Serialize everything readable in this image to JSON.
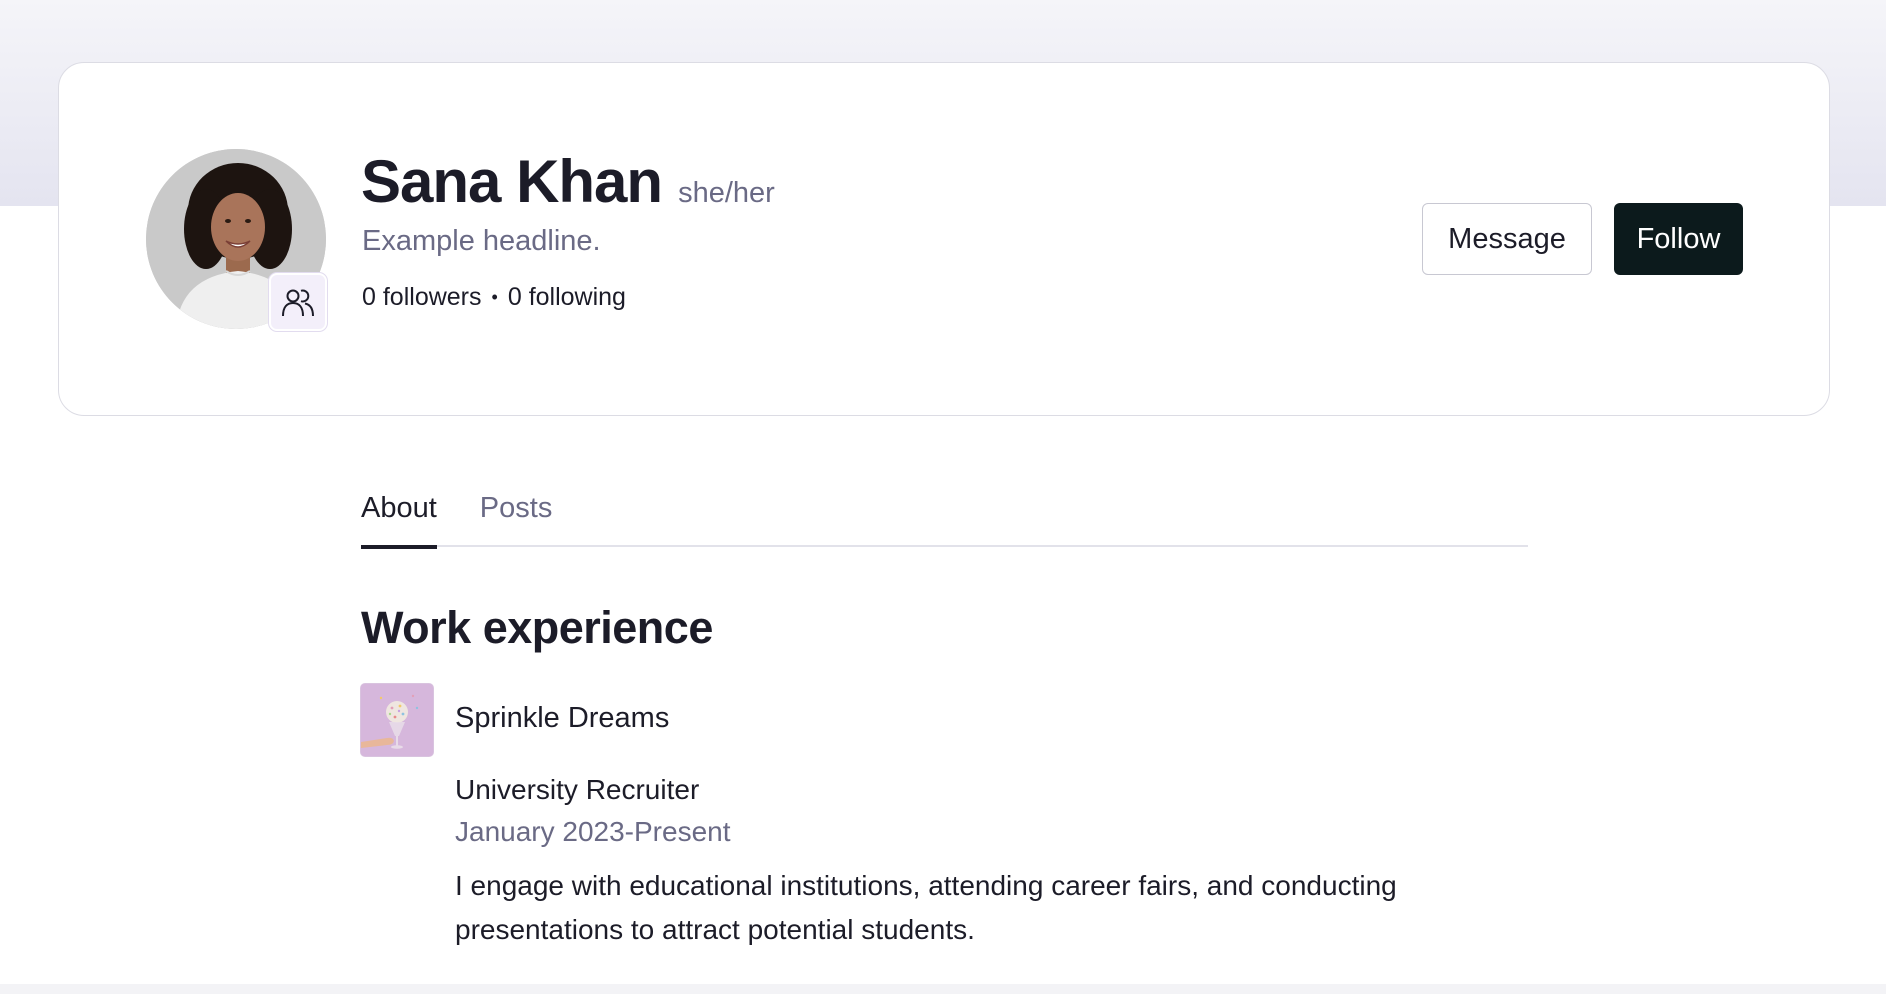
{
  "profile": {
    "name": "Sana Khan",
    "pronouns": "she/her",
    "headline": "Example headline.",
    "followers_count": "0",
    "followers_label": "followers",
    "following_count": "0",
    "following_label": "following",
    "separator": "•",
    "badge_icon": "people-icon"
  },
  "actions": {
    "message_label": "Message",
    "follow_label": "Follow"
  },
  "tabs": [
    {
      "label": "About",
      "active": true
    },
    {
      "label": "Posts",
      "active": false
    }
  ],
  "work_experience": {
    "title": "Work experience",
    "items": [
      {
        "company": "Sprinkle Dreams",
        "role": "University Recruiter",
        "dates": "January 2023-Present",
        "description": "I engage with educational institutions, attending career fairs, and conducting presentations to attract potential students."
      }
    ]
  },
  "colors": {
    "follow_button_bg": "#0c1a1c",
    "muted_text": "#6a6a85",
    "primary_text": "#1c1c28",
    "badge_bg": "#f3effa",
    "company_logo_bg": "#d6b7dc"
  }
}
